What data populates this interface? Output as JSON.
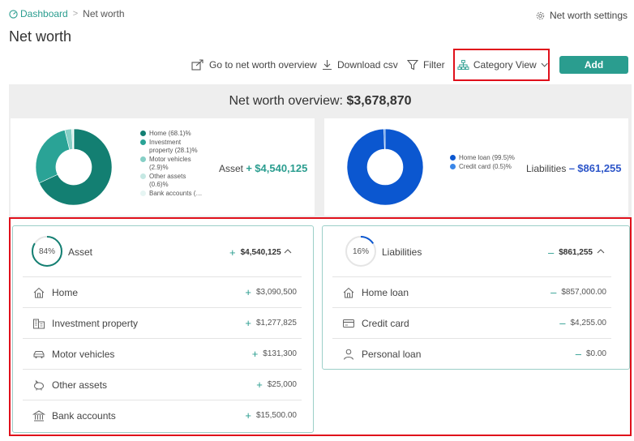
{
  "breadcrumb": {
    "home": "Dashboard",
    "separator": ">",
    "current": "Net worth"
  },
  "header": {
    "settings_label": "Net worth settings",
    "title": "Net worth"
  },
  "toolbar": {
    "overview_label": "Go to net worth overview",
    "download_label": "Download csv",
    "filter_label": "Filter",
    "category_label": "Category View",
    "add_label": "Add"
  },
  "overview": {
    "title_prefix": "Net worth overview:",
    "title_amount": "$3,678,870",
    "assets": {
      "total_label": "Asset",
      "total_sign": "+",
      "total_amount": "$4,540,125",
      "legend": [
        {
          "label": "Home (68.1)%",
          "color": "#137f72",
          "value": 68.1
        },
        {
          "label": "Investment property (28.1)%",
          "color": "#2aa396",
          "value": 28.1
        },
        {
          "label": "Motor vehicles (2.9)%",
          "color": "#86cfc6",
          "value": 2.9
        },
        {
          "label": "Other assets (0.6)%",
          "color": "#c5e8e3",
          "value": 0.6
        },
        {
          "label": "Bank accounts (…",
          "color": "#e6f5f3",
          "value": 0.3
        }
      ]
    },
    "liabilities": {
      "total_label": "Liabilities",
      "total_sign": "–",
      "total_amount": "$861,255",
      "legend": [
        {
          "label": "Home loan (99.5)%",
          "color": "#0b57d0",
          "value": 99.5
        },
        {
          "label": "Credit card (0.5)%",
          "color": "#3a86e8",
          "value": 0.5
        }
      ]
    }
  },
  "assets_panel": {
    "percent": "84%",
    "percent_value": 84,
    "title": "Asset",
    "sign": "+",
    "amount": "$4,540,125",
    "chevron": "^",
    "rows": [
      {
        "label": "Home",
        "sign": "+",
        "amount": "$3,090,500",
        "icon": "house-icon"
      },
      {
        "label": "Investment property",
        "sign": "+",
        "amount": "$1,277,825",
        "icon": "building-icon"
      },
      {
        "label": "Motor vehicles",
        "sign": "+",
        "amount": "$131,300",
        "icon": "car-icon"
      },
      {
        "label": "Other assets",
        "sign": "+",
        "amount": "$25,000",
        "icon": "piggy-bank-icon"
      },
      {
        "label": "Bank accounts",
        "sign": "+",
        "amount": "$15,500.00",
        "icon": "bank-icon"
      }
    ]
  },
  "liabilities_panel": {
    "percent": "16%",
    "percent_value": 16,
    "title": "Liabilities",
    "sign": "–",
    "amount": "$861,255",
    "chevron": "^",
    "rows": [
      {
        "label": "Home loan",
        "sign": "–",
        "amount": "$857,000.00",
        "icon": "house-loan-icon"
      },
      {
        "label": "Credit card",
        "sign": "–",
        "amount": "$4,255.00",
        "icon": "credit-card-icon"
      },
      {
        "label": "Personal loan",
        "sign": "–",
        "amount": "$0.00",
        "icon": "person-icon"
      }
    ]
  }
}
